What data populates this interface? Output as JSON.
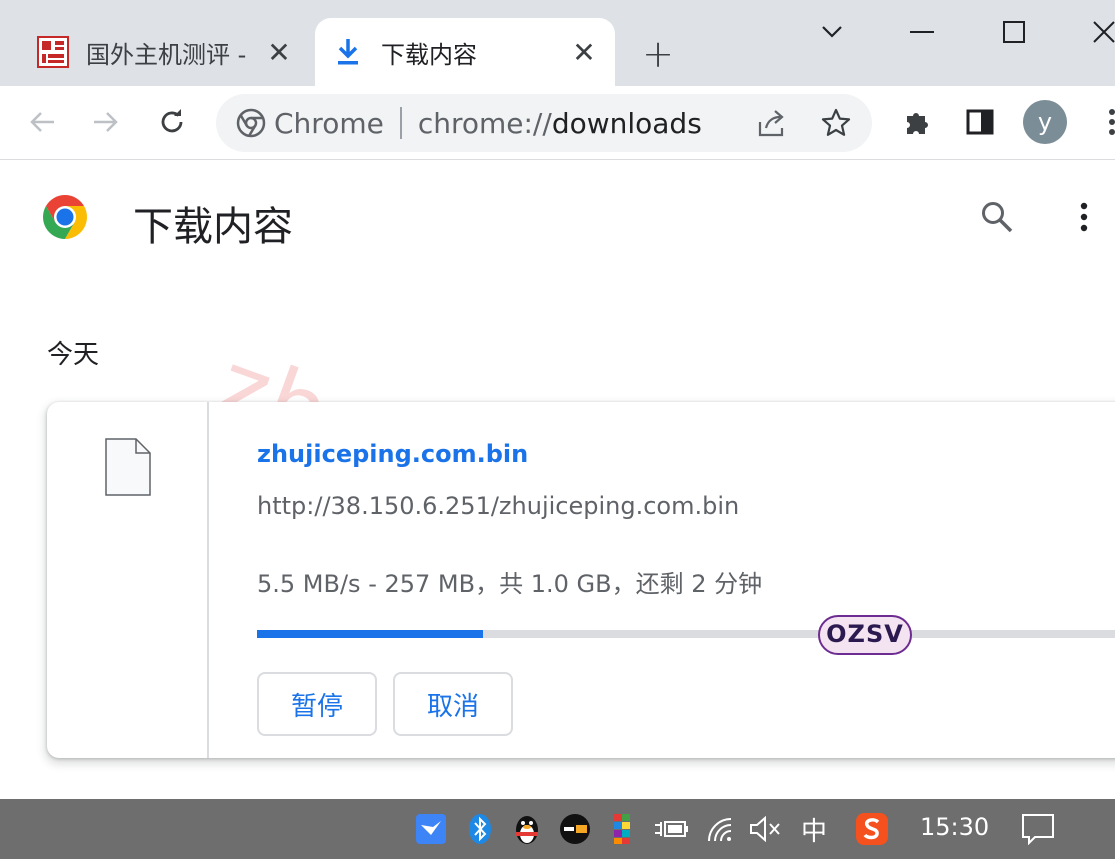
{
  "browser": {
    "tabs": [
      {
        "title": "国外主机测评 - |",
        "active": false,
        "icon": "site-favicon"
      },
      {
        "title": "下载内容",
        "active": true,
        "icon": "download-icon"
      }
    ],
    "omnibox": {
      "site_label": "Chrome",
      "url_scheme": "chrome://",
      "url_host": "downloads"
    },
    "profile_initial": "y"
  },
  "page": {
    "title": "下载内容",
    "watermark": "zhujiceping.com",
    "section_date": "今天",
    "download": {
      "file_name": "zhujiceping.com.bin",
      "url": "http://38.150.6.251/zhujiceping.com.bin",
      "status": "5.5 MB/s - 257 MB，共 1.0 GB，还剩 2 分钟",
      "progress_fraction": 0.257,
      "pause_label": "暂停",
      "cancel_label": "取消"
    },
    "sticker_text": "OZSV"
  },
  "taskbar": {
    "ime_label": "中",
    "clock": "15:30"
  },
  "colors": {
    "accent": "#1a73e8",
    "tabstrip": "#dee1e6",
    "taskbar": "#6e6e6e"
  }
}
